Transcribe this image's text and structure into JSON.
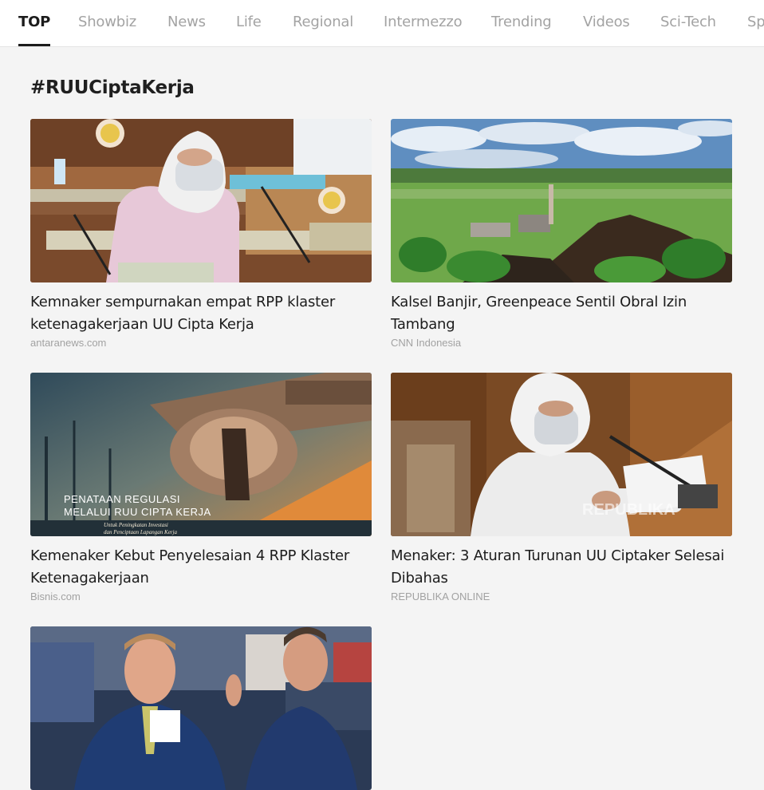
{
  "tabs": [
    {
      "label": "TOP",
      "active": true
    },
    {
      "label": "Showbiz",
      "active": false
    },
    {
      "label": "News",
      "active": false
    },
    {
      "label": "Life",
      "active": false
    },
    {
      "label": "Regional",
      "active": false
    },
    {
      "label": "Intermezzo",
      "active": false
    },
    {
      "label": "Trending",
      "active": false
    },
    {
      "label": "Videos",
      "active": false
    },
    {
      "label": "Sci-Tech",
      "active": false
    },
    {
      "label": "Sp",
      "active": false
    }
  ],
  "hashtag": "#RUUCiptaKerja",
  "articles": [
    {
      "title": "Kemnaker sempurnakan empat RPP klaster ketenagakerjaan UU Cipta Kerja",
      "source": "antaranews.com"
    },
    {
      "title": "Kalsel Banjir, Greenpeace Sentil Obral Izin Tambang",
      "source": "CNN Indonesia"
    },
    {
      "title": "Kemenaker Kebut Penyelesaian 4 RPP Klaster Ketenagakerjaan",
      "source": "Bisnis.com",
      "image_text": {
        "line1": "PENATAAN REGULASI",
        "line2": "MELALUI RUU CIPTA KERJA",
        "line3": "Untuk Peningkatan Investasi",
        "line4": "dan Penciptaan Lapangan Kerja"
      }
    },
    {
      "title": "Menaker: 3 Aturan Turunan UU Ciptaker Selesai Dibahas",
      "source": "REPUBLIKA ONLINE",
      "image_text": {
        "watermark": "REPUBLIKA"
      }
    },
    {
      "title": "",
      "source": ""
    }
  ]
}
